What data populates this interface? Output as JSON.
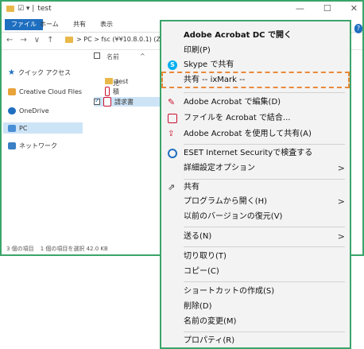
{
  "window": {
    "title": "test",
    "quick_access": "☑ ▾ |",
    "minimize": "—",
    "maximize": "☐",
    "close": "✕"
  },
  "ribbon": {
    "file": "ファイル",
    "tabs": [
      "ホーム",
      "共有",
      "表示"
    ]
  },
  "address": {
    "nav": [
      "←",
      "→",
      "∨",
      "↑"
    ],
    "path": "> PC > fsc (¥¥10.8.0.1) (Z:) > k"
  },
  "sidebar": {
    "items": [
      {
        "label": "クイック アクセス",
        "icon": "star-icon"
      },
      {
        "label": "Creative Cloud Files",
        "icon": "cloud-files-icon"
      },
      {
        "label": "OneDrive",
        "icon": "onedrive-icon"
      },
      {
        "label": "PC",
        "icon": "pc-icon"
      },
      {
        "label": "ネットワーク",
        "icon": "network-icon"
      }
    ]
  },
  "filelist": {
    "header": "名前",
    "sort_glyph": "^",
    "files": [
      {
        "name": "test",
        "icon": "folder-icon"
      },
      {
        "name": "見積書",
        "icon": "pdf-icon"
      },
      {
        "name": "請求書",
        "icon": "pdf-icon"
      }
    ]
  },
  "status": {
    "count": "3 個の項目",
    "selected": "1 個の項目を選択 42.0 KB"
  },
  "context_menu": {
    "items": {
      "open_acrobat": "Adobe Acrobat DC で開く",
      "print": "印刷(P)",
      "skype_share": "Skype で共有",
      "ixmark_share": "共有 -- ixMark --",
      "edit_acrobat": "Adobe Acrobat で編集(D)",
      "combine_acrobat": "ファイルを Acrobat で結合...",
      "share_acrobat": "Adobe Acrobat を使用して共有(A)",
      "eset_scan": "ESET Internet Securityで検査する",
      "advanced_options": "詳細設定オプション",
      "share": "共有",
      "open_with": "プログラムから開く(H)",
      "restore_previous": "以前のバージョンの復元(V)",
      "send_to": "送る(N)",
      "cut": "切り取り(T)",
      "copy": "コピー(C)",
      "create_shortcut": "ショートカットの作成(S)",
      "delete": "削除(D)",
      "rename": "名前の変更(M)",
      "properties": "プロパティ(R)"
    },
    "submenu_arrow": ">"
  },
  "colors": {
    "frame_green": "#3aa56a",
    "dash_orange": "#e8893a",
    "selection_blue": "#cde4f7",
    "acrobat_red": "#c8102e",
    "skype_blue": "#00aff0"
  }
}
